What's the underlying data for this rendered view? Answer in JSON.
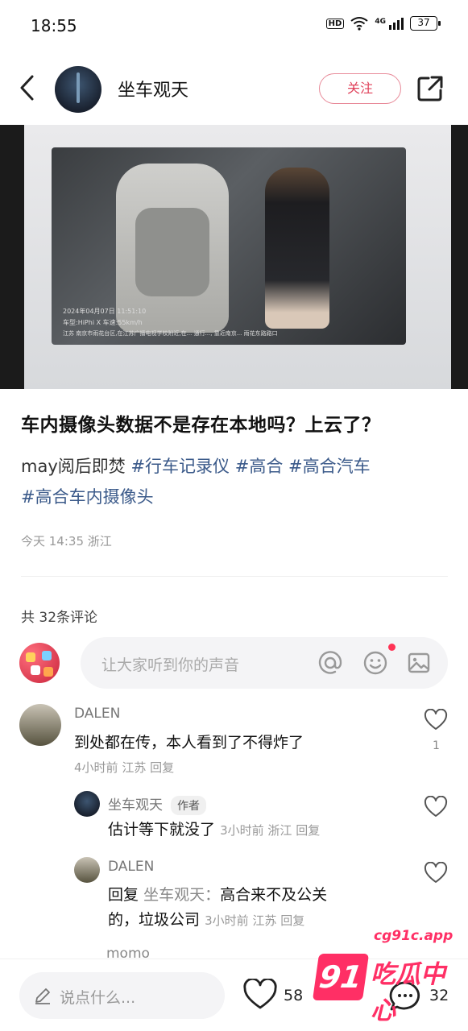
{
  "status_bar": {
    "time": "18:55",
    "network": "4G",
    "battery": "37",
    "hd": "HD"
  },
  "header": {
    "username": "坐车观天",
    "follow_label": "关注"
  },
  "photo": {
    "overlay_date": "2024年04月07日  11:51:10",
    "overlay_model": "车型:HiPhi X  车速:55km/h",
    "overlay_location": "江苏 南京市雨花台区,在江苏广播电视学校附近,在... 通行..., 靠近南京... 雨花东路路口"
  },
  "post": {
    "title": "车内摄像头数据不是存在本地吗？上云了？",
    "body_prefix": "may阅后即焚",
    "tags": [
      "#行车记录仪",
      "#高合",
      "#高合汽车",
      "#高合车内摄像头"
    ],
    "time": "今天 14:35",
    "location": "浙江"
  },
  "comments_header": {
    "count_label": "共 32条评论"
  },
  "comment_input": {
    "placeholder": "让大家听到你的声音"
  },
  "comments": [
    {
      "user": "DALEN",
      "text": "到处都在传，本人看到了不得炸了",
      "time": "4小时前",
      "location": "江苏",
      "reply": "回复",
      "likes": "1"
    },
    {
      "user": "坐车观天",
      "badge": "作者",
      "text": "估计等下就没了",
      "time": "3小时前",
      "location": "浙江",
      "reply": "回复"
    },
    {
      "user": "DALEN",
      "reply_prefix": "回复",
      "reply_to": "坐车观天：",
      "text_line1": "高合来不及公关",
      "text_line2": "的，垃圾公司",
      "time": "3小时前",
      "location": "江苏",
      "reply": "回复"
    },
    {
      "user": "momo"
    }
  ],
  "bottom_bar": {
    "placeholder": "说点什么...",
    "likes": "58",
    "comments": "32"
  },
  "watermark": {
    "number": "91",
    "url": "cg91c.app",
    "text": "吃瓜中心"
  },
  "colors": {
    "accent": "#e0415a",
    "tag": "#3b5a8a",
    "watermark": "#ff2f65"
  }
}
